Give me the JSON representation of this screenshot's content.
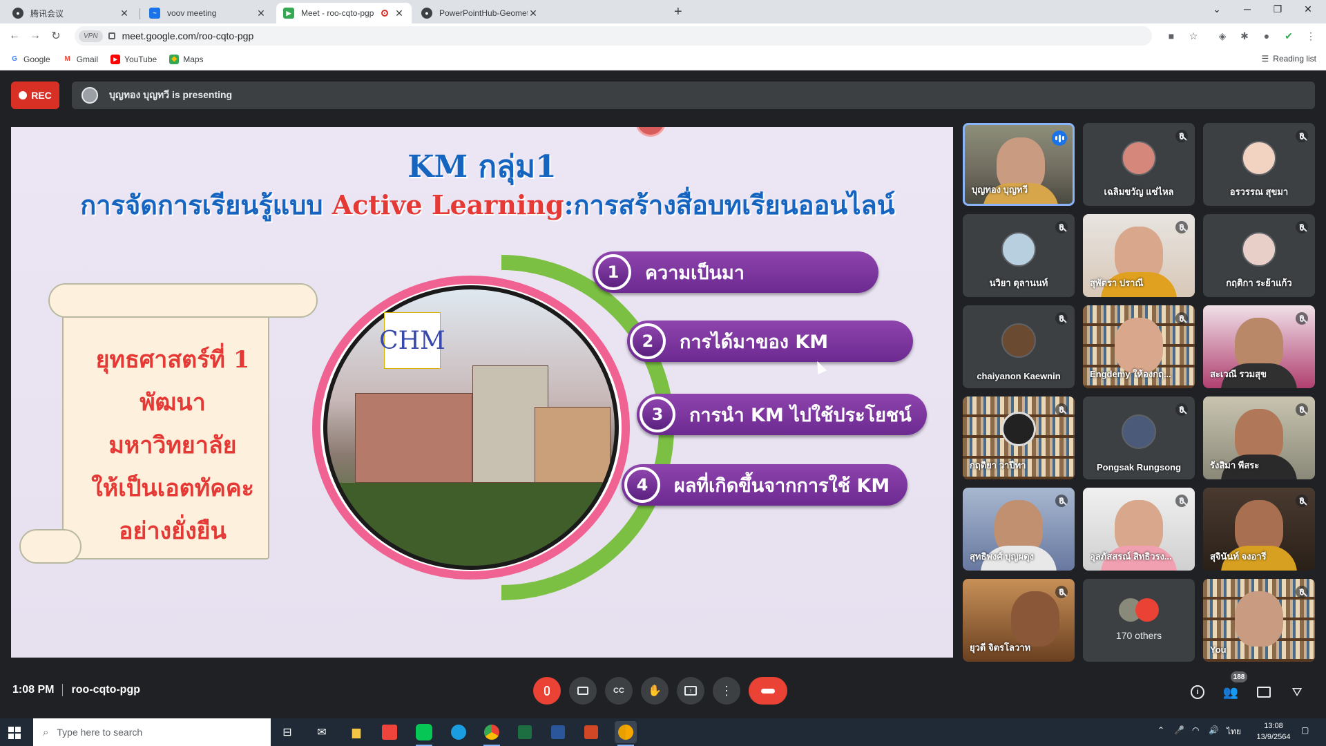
{
  "browser": {
    "tabs": [
      {
        "title": "腾讯会议",
        "icon": "google-chrome-icon",
        "active": false
      },
      {
        "title": "voov meeting",
        "icon": "voov-icon",
        "active": false
      },
      {
        "title": "Meet - roo-cqto-pgp",
        "icon": "google-meet-icon",
        "active": true,
        "recording": true
      },
      {
        "title": "PowerPointHub-Geometric Desig",
        "icon": "google-chrome-icon",
        "active": false
      }
    ],
    "url": "meet.google.com/roo-cqto-pgp",
    "vpn_label": "VPN",
    "bookmarks": [
      {
        "label": "Google",
        "icon": "google-icon"
      },
      {
        "label": "Gmail",
        "icon": "gmail-icon"
      },
      {
        "label": "YouTube",
        "icon": "youtube-icon"
      },
      {
        "label": "Maps",
        "icon": "maps-icon"
      }
    ],
    "reading_list": "Reading list"
  },
  "meet": {
    "rec_label": "REC",
    "presenting_text": "บุญทอง บุญทวี is presenting",
    "slide": {
      "title": "KM กลุ่ม1",
      "subtitle_part1": "การจัดการเรียนรู้แบบ ",
      "subtitle_highlight": "Active Learning",
      "subtitle_part2": ":การสร้างสื่อบทเรียนออนไลน์",
      "scroll_lines": [
        "ยุทธศาสตร์ที่ 1",
        "พัฒนา",
        "มหาวิทยาลัย",
        "ให้เป็นเอตทัคคะ",
        "อย่างยั่งยืน"
      ],
      "logo_text": "CHM",
      "items": [
        {
          "num": "1",
          "label": "ความเป็นมา"
        },
        {
          "num": "2",
          "label": "การได้มาของ KM"
        },
        {
          "num": "3",
          "label": "การนำ KM ไปใช้ประโยชน์"
        },
        {
          "num": "4",
          "label": "ผลที่เกิดขึ้นจากการใช้ KM"
        }
      ]
    },
    "participants": [
      {
        "name": "บุญทอง บุญทวี",
        "type": "video",
        "speaking": true
      },
      {
        "name": "เฉลิมขวัญ แซ่ไหล",
        "type": "avatar",
        "muted": true
      },
      {
        "name": "อรวรรณ สุขมา",
        "type": "avatar",
        "muted": true
      },
      {
        "name": "นวิยา ดุลานนท์",
        "type": "avatar",
        "muted": true
      },
      {
        "name": "สุพัตรา ปราณี",
        "type": "video",
        "muted": true
      },
      {
        "name": "กฤติกา ระย้าแก้ว",
        "type": "avatar",
        "muted": true
      },
      {
        "name": "chaiyanon Kaewnin",
        "type": "avatar",
        "muted": true
      },
      {
        "name": "Engdemy ให้องกฤ...",
        "type": "video",
        "muted": true
      },
      {
        "name": "สะเวณี รวมสุข",
        "type": "video",
        "muted": true
      },
      {
        "name": "กฤติยา วาปีทา",
        "type": "video",
        "muted": true
      },
      {
        "name": "Pongsak Rungsong",
        "type": "avatar",
        "muted": true
      },
      {
        "name": "รังสิมา พีสระ",
        "type": "video",
        "muted": true
      },
      {
        "name": "สุทธิพงศ์ บุญผดุง",
        "type": "video",
        "muted": true
      },
      {
        "name": "อุลภัสสรณ์ สิทธิวรง...",
        "type": "video",
        "muted": true
      },
      {
        "name": "สุจินันท์ จงอารี",
        "type": "video",
        "muted": true
      },
      {
        "name": "ยุวดี จิตรโลวาท",
        "type": "video",
        "muted": true
      },
      {
        "name": "170 others",
        "type": "others"
      },
      {
        "name": "You",
        "type": "video",
        "muted": true
      }
    ],
    "time": "1:08 PM",
    "meeting_code": "roo-cqto-pgp",
    "people_count": "188"
  },
  "taskbar": {
    "search_placeholder": "Type here to search",
    "lang": "ไทย",
    "clock_time": "13:08",
    "clock_date": "13/9/2564"
  }
}
